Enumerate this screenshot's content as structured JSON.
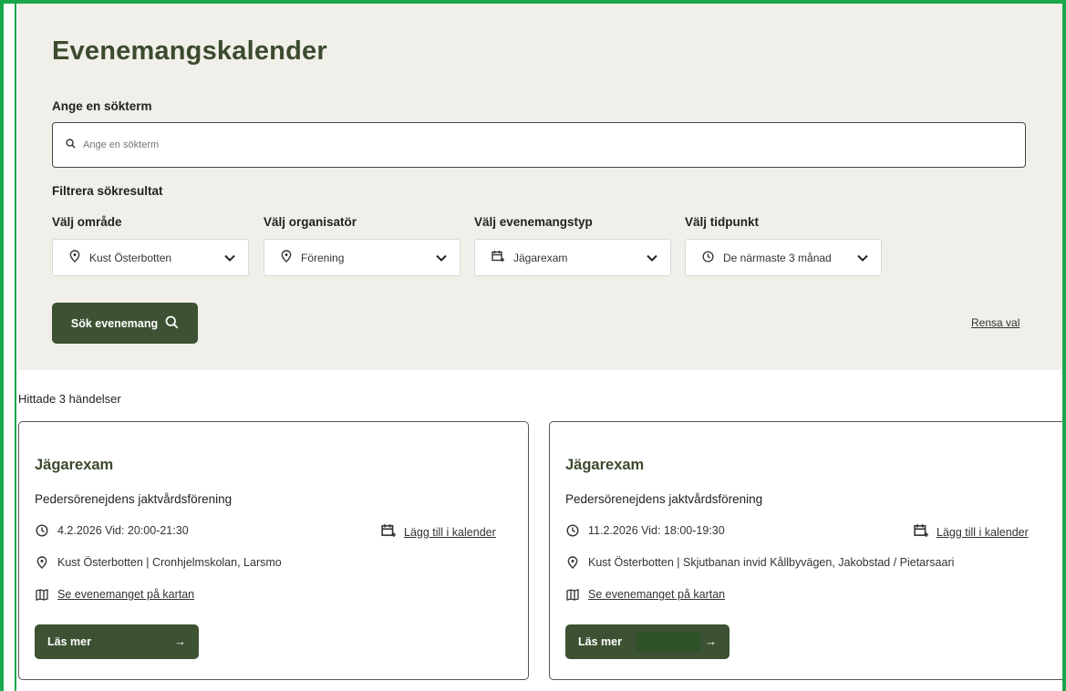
{
  "header": {
    "title": "Evenemangskalender",
    "search_label": "Ange en sökterm",
    "search_placeholder": "Ange en sökterm",
    "filter_heading": "Filtrera sökresultat"
  },
  "filters": [
    {
      "label": "Välj område",
      "value": "Kust Österbotten",
      "icon": "location-pin-icon"
    },
    {
      "label": "Välj organisatör",
      "value": "Förening",
      "icon": "location-pin-icon"
    },
    {
      "label": "Välj evenemangstyp",
      "value": "Jägarexam",
      "icon": "calendar-add-icon"
    },
    {
      "label": "Välj tidpunkt",
      "value": "De närmaste 3 månad",
      "icon": "clock-icon"
    }
  ],
  "actions": {
    "search_button": "Sök evenemang",
    "clear_link": "Rensa val"
  },
  "results": {
    "count_text": "Hittade 3 händelser",
    "events": [
      {
        "title": "Jägarexam",
        "organizer": "Pedersörenejdens jaktvårdsförening",
        "datetime": "4.2.2026 Vid: 20:00-21:30",
        "add_to_calendar": "Lägg till i kalender",
        "location": "Kust Österbotten | Cronhjelmskolan, Larsmo",
        "map_link": "Se evenemanget på kartan",
        "read_more": "Läs mer"
      },
      {
        "title": "Jägarexam",
        "organizer": "Pedersörenejdens jaktvårdsförening",
        "datetime": "11.2.2026 Vid: 18:00-19:30",
        "add_to_calendar": "Lägg till i kalender",
        "location": "Kust Österbotten | Skjutbanan invid Kållbyvägen, Jakobstad / Pietarsaari",
        "map_link": "Se evenemanget på kartan",
        "read_more": "Läs mer"
      }
    ]
  },
  "colors": {
    "accent_green": "#3c5233",
    "title_green": "#3c4a2e",
    "panel_bg": "#f1efea",
    "frame_green": "#1aa84b"
  }
}
